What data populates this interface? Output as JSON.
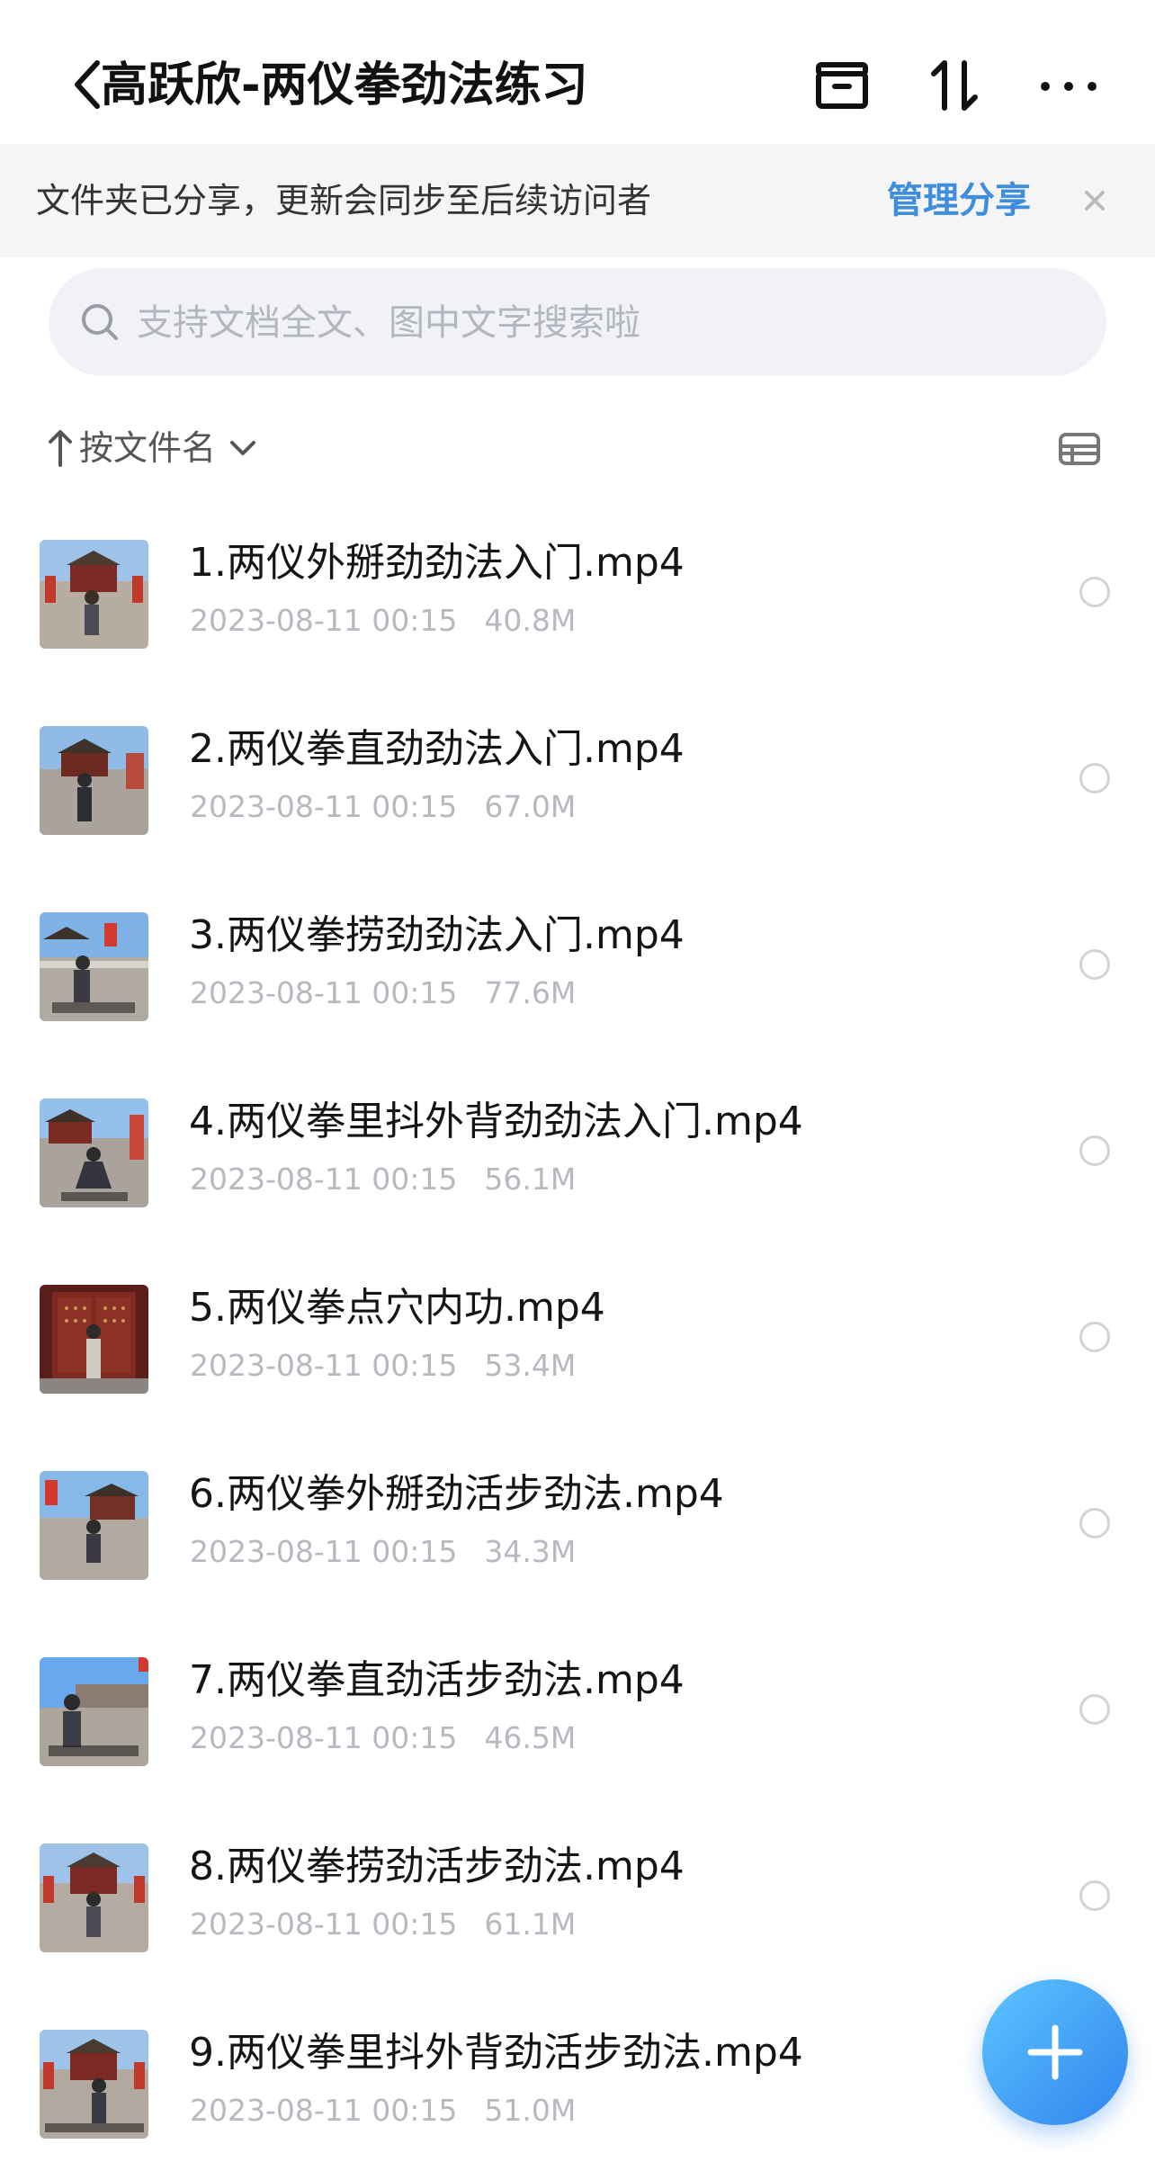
{
  "header": {
    "title": "高跃欣-两仪拳劲法练习"
  },
  "share_banner": {
    "text": "文件夹已分享，更新会同步至后续访问者",
    "manage_label": "管理分享"
  },
  "search": {
    "placeholder": "支持文档全文、图中文字搜索啦"
  },
  "sort": {
    "label": "按文件名"
  },
  "files": [
    {
      "name": "1.两仪外掰劲劲法入门.mp4",
      "date": "2023-08-11 00:15",
      "size": "40.8M"
    },
    {
      "name": "2.两仪拳直劲劲法入门.mp4",
      "date": "2023-08-11 00:15",
      "size": "67.0M"
    },
    {
      "name": "3.两仪拳捞劲劲法入门.mp4",
      "date": "2023-08-11 00:15",
      "size": "77.6M"
    },
    {
      "name": "4.两仪拳里抖外背劲劲法入门.mp4",
      "date": "2023-08-11 00:15",
      "size": "56.1M"
    },
    {
      "name": "5.两仪拳点穴内功.mp4",
      "date": "2023-08-11 00:15",
      "size": "53.4M"
    },
    {
      "name": "6.两仪拳外掰劲活步劲法.mp4",
      "date": "2023-08-11 00:15",
      "size": "34.3M"
    },
    {
      "name": "7.两仪拳直劲活步劲法.mp4",
      "date": "2023-08-11 00:15",
      "size": "46.5M"
    },
    {
      "name": "8.两仪拳捞劲活步劲法.mp4",
      "date": "2023-08-11 00:15",
      "size": "61.1M"
    },
    {
      "name": "9.两仪拳里抖外背劲活步劲法.mp4",
      "date": "2023-08-11 00:15",
      "size": "51.0M"
    }
  ],
  "colors": {
    "accent": "#3f8ede",
    "fab_start": "#5ec3ff",
    "fab_end": "#2f86ee",
    "meta_text": "#b7b9c0"
  },
  "icons": {
    "back": "chevron-left-icon",
    "archive": "archive-box-icon",
    "sort_toggle": "sort-arrows-icon",
    "more": "more-dots-icon",
    "close": "close-icon",
    "search": "search-icon",
    "view_toggle": "list-view-icon",
    "fab": "plus-icon"
  }
}
